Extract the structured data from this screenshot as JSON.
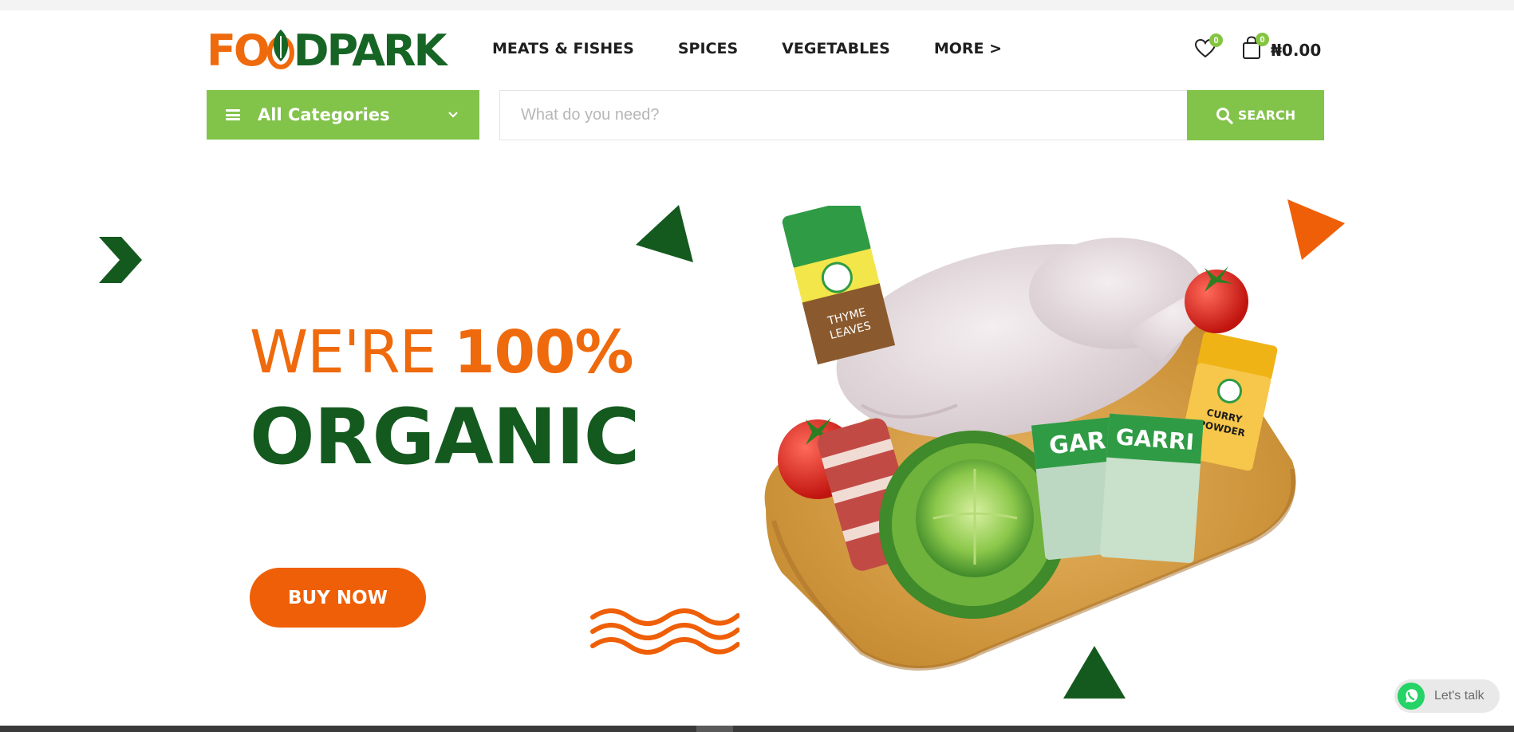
{
  "brand": {
    "logo_text_1": "FO",
    "logo_text_2": "DPARK",
    "logo_colors": {
      "orange": "#ef6a0c",
      "green": "#166525"
    }
  },
  "nav": {
    "items": [
      {
        "label": "MEATS & FISHES"
      },
      {
        "label": "SPICES"
      },
      {
        "label": "VEGETABLES"
      },
      {
        "label": "MORE >"
      }
    ]
  },
  "header": {
    "wishlist_icon": "heart-icon",
    "wishlist_count": "0",
    "cart_icon": "shopping-bag-icon",
    "cart_count": "0",
    "cart_total": "₦0.00"
  },
  "categories": {
    "label": "All Categories",
    "icon": "hamburger-menu-icon",
    "chevron": "chevron-down-icon"
  },
  "search": {
    "placeholder": "What do you need?",
    "value": "",
    "button_label": "SEARCH",
    "button_icon": "search-icon"
  },
  "hero": {
    "line1_light": "WE'RE ",
    "line1_bold": "100%",
    "line2": "ORGANIC",
    "cta_label": "BUY NOW",
    "product_labels": {
      "spice_jar": "THYME LEAVES",
      "curry_jar": "CURRY POWDER",
      "bag_1": "GAR",
      "bag_2": "GARRI"
    }
  },
  "chat": {
    "label": "Let's talk",
    "icon": "whatsapp-icon"
  },
  "colors": {
    "accent_green": "#82c34a",
    "dark_green": "#145a1f",
    "orange": "#ef6a0c"
  }
}
